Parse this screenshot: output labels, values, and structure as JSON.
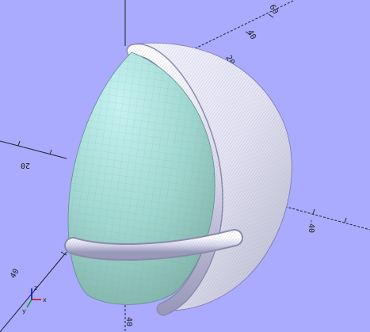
{
  "viewport": {
    "background": "#aaaaff",
    "axis_color": "#222222",
    "axis_labels": {
      "x_positive": "-40",
      "x_negative": "20",
      "y_positive": "40",
      "z_top": "60",
      "z_mid": "40",
      "z_low": "20",
      "z_bottom": "40"
    },
    "model": {
      "inner_surface_color": "#9fdcd4",
      "shell_color": "#eeeeff",
      "shell_line_color": "#7777aa"
    },
    "orientation_gizmo": {
      "x_label": "x",
      "y_label": "y",
      "z_label": "z",
      "x_color": "#dd0000",
      "y_color": "#00aa00",
      "z_color": "#0000dd"
    }
  }
}
